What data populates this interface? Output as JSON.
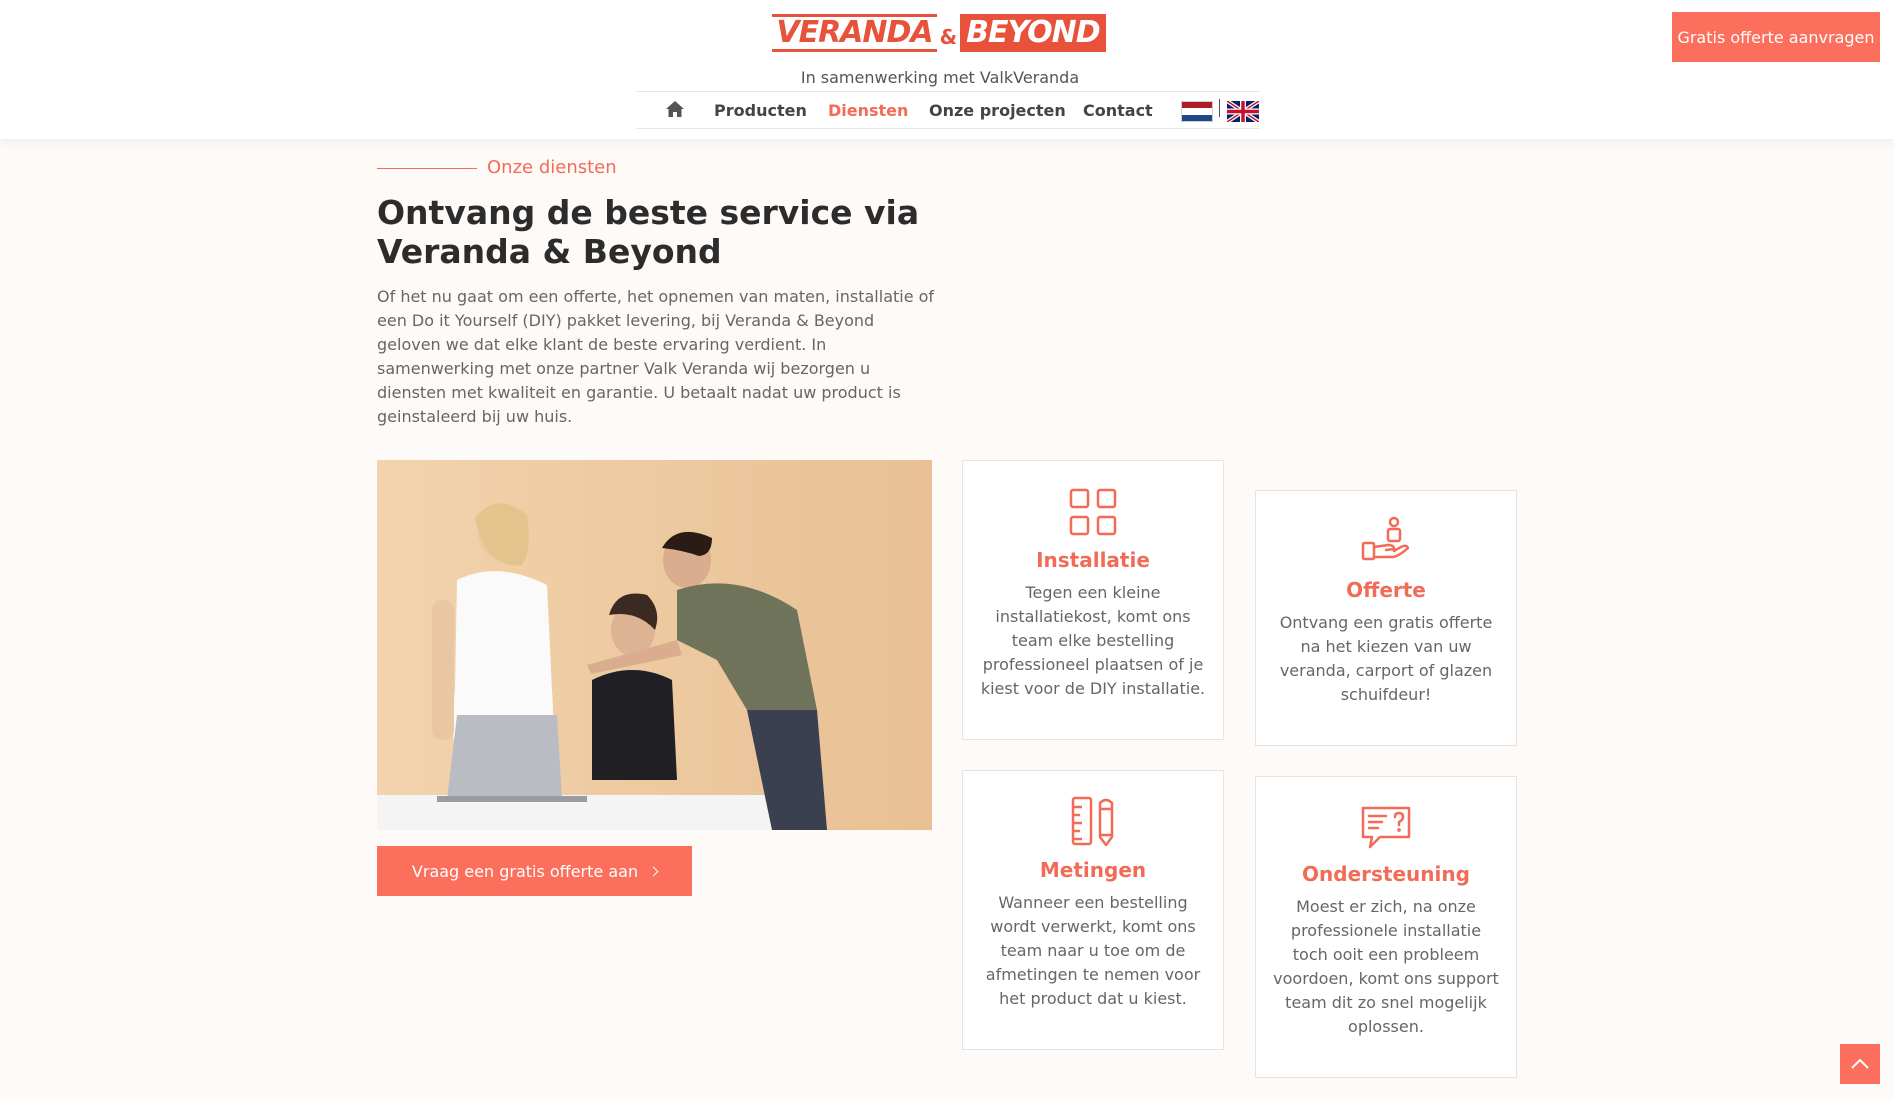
{
  "header": {
    "logo": {
      "left": "VERANDA",
      "amp": "&",
      "right": "BEYOND"
    },
    "tagline": "In samenwerking met ValkVeranda",
    "nav": {
      "home_icon": "home-icon",
      "items": [
        "Producten",
        "Diensten",
        "Onze projecten",
        "Contact"
      ],
      "active": "Diensten",
      "languages": [
        "nl-flag-icon",
        "uk-flag-icon"
      ]
    },
    "cta": "Gratis offerte aanvragen"
  },
  "section": {
    "eyebrow": "Onze diensten",
    "title": "Ontvang de beste service via Veranda & Beyond",
    "intro": "Of het nu gaat om een offerte, het opnemen van maten, installatie of een Do it Yourself (DIY) pakket levering, bij Veranda & Beyond geloven we dat elke klant de beste ervaring verdient. In samenwerking met onze partner Valk Veranda wij bezorgen u diensten met kwaliteit en garantie. U betaalt nadat uw product is geinstaleerd bij uw huis.",
    "cta": "Vraag een gratis offerte aan"
  },
  "services": [
    {
      "icon": "grid-icon",
      "title": "Installatie",
      "text": "Tegen een kleine installatiekost, komt ons team elke bestelling professioneel plaatsen of je kiest voor de DIY installatie."
    },
    {
      "icon": "hand-offer-icon",
      "title": "Offerte",
      "text": "Ontvang een gratis offerte na het kiezen van uw veranda, carport of glazen schuifdeur!"
    },
    {
      "icon": "ruler-pencil-icon",
      "title": "Metingen",
      "text": "Wanneer een bestelling wordt verwerkt, komt ons team naar u toe om de afmetingen te nemen voor het product dat u kiest."
    },
    {
      "icon": "chat-question-icon",
      "title": "Ondersteuning",
      "text": "Moest er zich, na onze professionele installatie toch ooit een probleem voordoen, komt ons support team dit zo snel mogelijk oplossen."
    }
  ],
  "colors": {
    "accent": "#f26b56",
    "button": "#fb6f5c",
    "background": "#fefaf7"
  }
}
